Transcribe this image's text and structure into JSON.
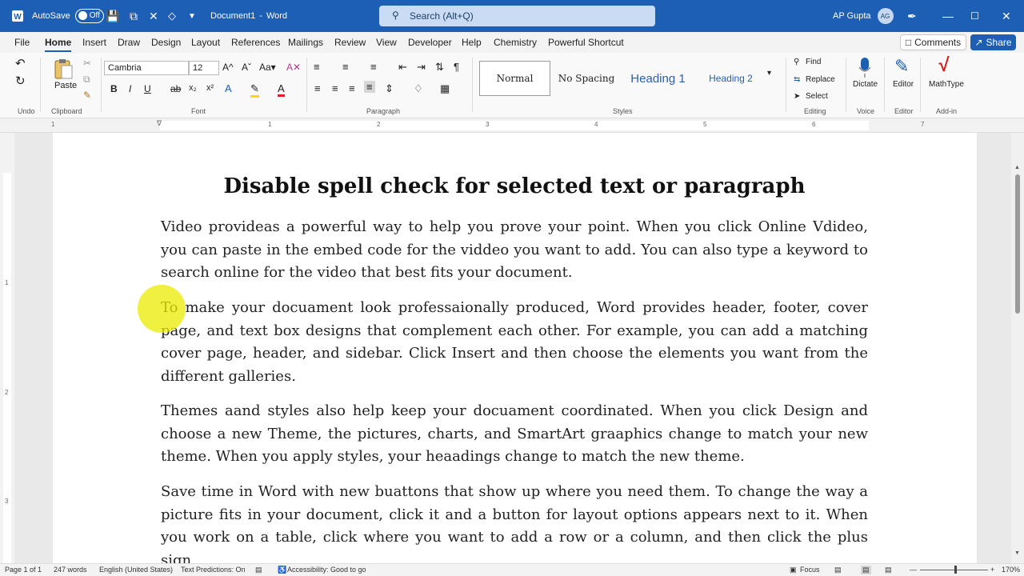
{
  "title_bar": {
    "autosave_label": "AutoSave",
    "autosave_state": "Off",
    "document_name": "Document1",
    "separator": "-",
    "app_name": "Word",
    "search_placeholder": "Search (Alt+Q)",
    "user_name": "AP Gupta",
    "user_initials": "AG",
    "accent_color": "#1d5fb4"
  },
  "menu": {
    "tabs": [
      "File",
      "Home",
      "Insert",
      "Draw",
      "Design",
      "Layout",
      "References",
      "Mailings",
      "Review",
      "View",
      "Developer",
      "Help",
      "Chemistry",
      "Powerful Shortcut"
    ],
    "active_tab": "Home",
    "comments_label": "Comments",
    "share_label": "Share"
  },
  "ribbon": {
    "paste_label": "Paste",
    "font_name": "Cambria",
    "font_size": "12",
    "styles": [
      "Normal",
      "No Spacing",
      "Heading 1",
      "Heading 2"
    ],
    "find_label": "Find",
    "replace_label": "Replace",
    "select_label": "Select",
    "dictate_label": "Dictate",
    "editor_label": "Editor",
    "mathtype_label": "MathType",
    "groups": {
      "undo": "Undo",
      "clipboard": "Clipboard",
      "font": "Font",
      "paragraph": "Paragraph",
      "styles": "Styles",
      "editing": "Editing",
      "voice": "Voice",
      "editor": "Editor",
      "addin": "Add-in"
    },
    "ruler_numbers": [
      "1",
      "1",
      "2",
      "3",
      "4",
      "5",
      "6",
      "7"
    ],
    "vruler_numbers": [
      "1",
      "2",
      "3"
    ]
  },
  "document": {
    "title": "Disable spell check for selected text or paragraph",
    "paragraphs": [
      "Video provideas a powerful way to help you prove your point. When you click Online Vdideo, you can paste in the embed code for the viddeo you want to add. You can also type a keyword to search online for the video that best fits your document.",
      "To make your docuament look professaionally produced, Word provides header, footer, cover page, and text box designs that complement each other. For example, you can add a matching cover page, header, and sidebar. Click Insert and then choose the elements you want from the different galleries.",
      "Themes aand styles also help keep your docuament coordinated. When you click Design and choose a new Theme, the pictures, charts, and SmartArt graaphics change to match your new theme. When you apply styles, your heaadings change to match the new theme.",
      "Save time in Word with new buattons that show up where you need them. To change the way a picture fits in your document, click it and a button for layout options appears next to it. When you work on a table, click where you want to add a row or a column, and then click the plus sign."
    ]
  },
  "status_bar": {
    "page": "Page 1 of 1",
    "words": "247 words",
    "language": "English (United States)",
    "text_predictions": "Text Predictions: On",
    "accessibility": "Accessibility: Good to go",
    "focus": "Focus",
    "zoom": "170%"
  }
}
